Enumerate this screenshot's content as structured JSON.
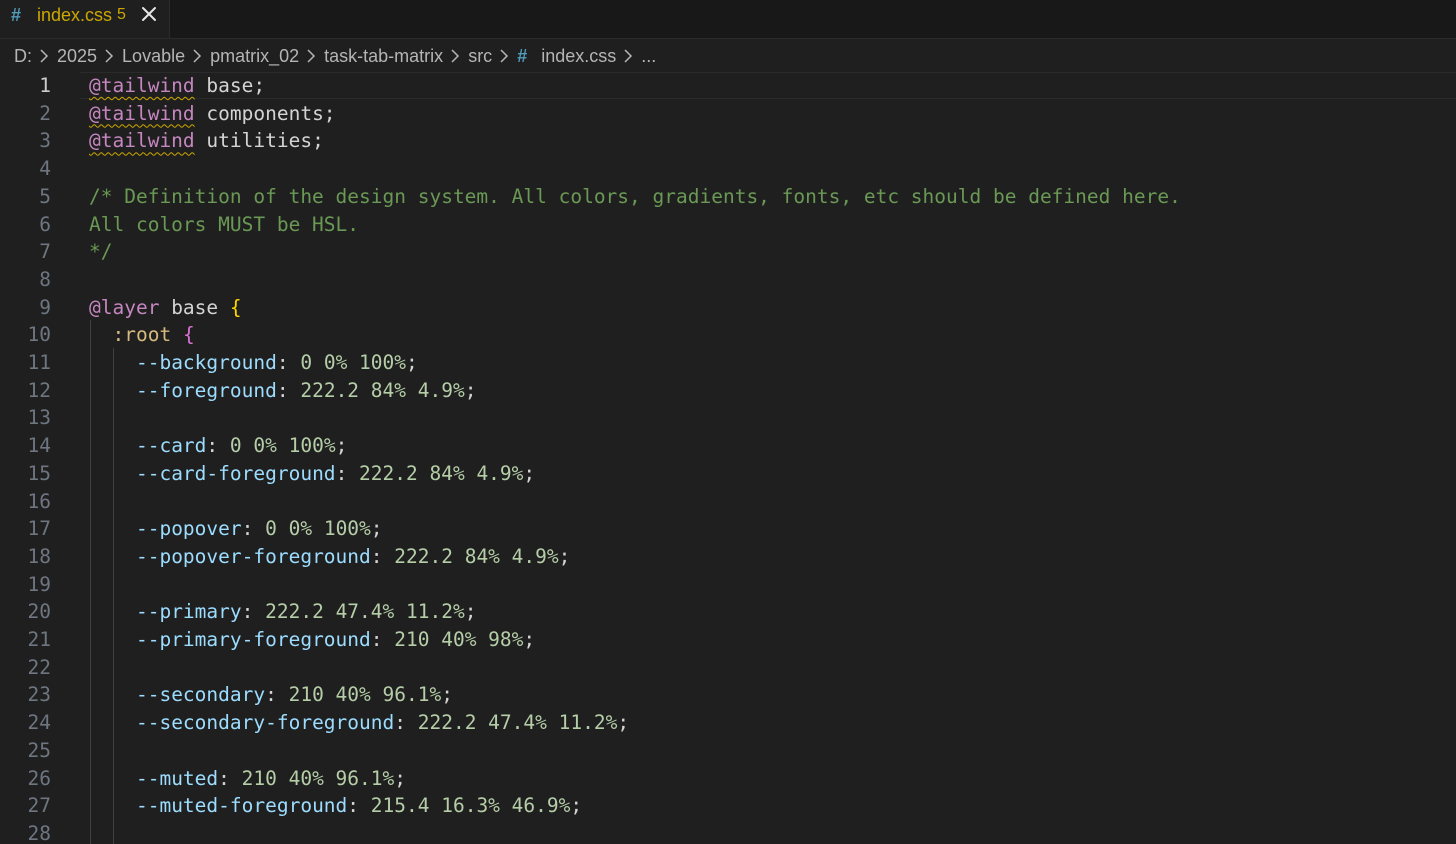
{
  "tab": {
    "icon": "css-hash-icon",
    "icon_glyph": "#",
    "filename": "index.css",
    "problem_count": "5",
    "close_icon": "close-icon"
  },
  "breadcrumb": {
    "segments": [
      "D:",
      "2025",
      "Lovable",
      "pmatrix_02",
      "task-tab-matrix",
      "src"
    ],
    "file_icon_glyph": "#",
    "file": "index.css",
    "more": "..."
  },
  "colors": {
    "background": "#1f1f1f",
    "at_rule": "#c586c0",
    "comment": "#6a9955",
    "property": "#9cdcfe",
    "value": "#b5cea8",
    "brace": "#ffd700",
    "warning": "#cca700"
  },
  "editor": {
    "active_line": 1,
    "lines": [
      {
        "n": "1",
        "tokens": [
          {
            "c": "atsq",
            "t": "@tailwind"
          },
          {
            "c": "plain",
            "t": " base;"
          }
        ]
      },
      {
        "n": "2",
        "tokens": [
          {
            "c": "atsq",
            "t": "@tailwind"
          },
          {
            "c": "plain",
            "t": " components;"
          }
        ]
      },
      {
        "n": "3",
        "tokens": [
          {
            "c": "atsq",
            "t": "@tailwind"
          },
          {
            "c": "plain",
            "t": " utilities;"
          }
        ]
      },
      {
        "n": "4",
        "tokens": []
      },
      {
        "n": "5",
        "tokens": [
          {
            "c": "comment",
            "t": "/* Definition of the design system. All colors, gradients, fonts, etc should be defined here."
          }
        ]
      },
      {
        "n": "6",
        "tokens": [
          {
            "c": "comment",
            "t": "All colors MUST be HSL."
          }
        ]
      },
      {
        "n": "7",
        "tokens": [
          {
            "c": "comment",
            "t": "*/"
          }
        ]
      },
      {
        "n": "8",
        "tokens": []
      },
      {
        "n": "9",
        "tokens": [
          {
            "c": "at",
            "t": "@layer"
          },
          {
            "c": "plain",
            "t": " base "
          },
          {
            "c": "brace-1",
            "t": "{"
          }
        ]
      },
      {
        "n": "10",
        "tokens": [
          {
            "c": "plain",
            "t": "  "
          },
          {
            "c": "selector",
            "t": ":root"
          },
          {
            "c": "plain",
            "t": " "
          },
          {
            "c": "brace-2",
            "t": "{"
          }
        ]
      },
      {
        "n": "11",
        "tokens": [
          {
            "c": "plain",
            "t": "    "
          },
          {
            "c": "prop",
            "t": "--background"
          },
          {
            "c": "plain",
            "t": ": "
          },
          {
            "c": "val",
            "t": "0 0% 100%"
          },
          {
            "c": "plain",
            "t": ";"
          }
        ]
      },
      {
        "n": "12",
        "tokens": [
          {
            "c": "plain",
            "t": "    "
          },
          {
            "c": "prop",
            "t": "--foreground"
          },
          {
            "c": "plain",
            "t": ": "
          },
          {
            "c": "val",
            "t": "222.2 84% 4.9%"
          },
          {
            "c": "plain",
            "t": ";"
          }
        ]
      },
      {
        "n": "13",
        "tokens": []
      },
      {
        "n": "14",
        "tokens": [
          {
            "c": "plain",
            "t": "    "
          },
          {
            "c": "prop",
            "t": "--card"
          },
          {
            "c": "plain",
            "t": ": "
          },
          {
            "c": "val",
            "t": "0 0% 100%"
          },
          {
            "c": "plain",
            "t": ";"
          }
        ]
      },
      {
        "n": "15",
        "tokens": [
          {
            "c": "plain",
            "t": "    "
          },
          {
            "c": "prop",
            "t": "--card-foreground"
          },
          {
            "c": "plain",
            "t": ": "
          },
          {
            "c": "val",
            "t": "222.2 84% 4.9%"
          },
          {
            "c": "plain",
            "t": ";"
          }
        ]
      },
      {
        "n": "16",
        "tokens": []
      },
      {
        "n": "17",
        "tokens": [
          {
            "c": "plain",
            "t": "    "
          },
          {
            "c": "prop",
            "t": "--popover"
          },
          {
            "c": "plain",
            "t": ": "
          },
          {
            "c": "val",
            "t": "0 0% 100%"
          },
          {
            "c": "plain",
            "t": ";"
          }
        ]
      },
      {
        "n": "18",
        "tokens": [
          {
            "c": "plain",
            "t": "    "
          },
          {
            "c": "prop",
            "t": "--popover-foreground"
          },
          {
            "c": "plain",
            "t": ": "
          },
          {
            "c": "val",
            "t": "222.2 84% 4.9%"
          },
          {
            "c": "plain",
            "t": ";"
          }
        ]
      },
      {
        "n": "19",
        "tokens": []
      },
      {
        "n": "20",
        "tokens": [
          {
            "c": "plain",
            "t": "    "
          },
          {
            "c": "prop",
            "t": "--primary"
          },
          {
            "c": "plain",
            "t": ": "
          },
          {
            "c": "val",
            "t": "222.2 47.4% 11.2%"
          },
          {
            "c": "plain",
            "t": ";"
          }
        ]
      },
      {
        "n": "21",
        "tokens": [
          {
            "c": "plain",
            "t": "    "
          },
          {
            "c": "prop",
            "t": "--primary-foreground"
          },
          {
            "c": "plain",
            "t": ": "
          },
          {
            "c": "val",
            "t": "210 40% 98%"
          },
          {
            "c": "plain",
            "t": ";"
          }
        ]
      },
      {
        "n": "22",
        "tokens": []
      },
      {
        "n": "23",
        "tokens": [
          {
            "c": "plain",
            "t": "    "
          },
          {
            "c": "prop",
            "t": "--secondary"
          },
          {
            "c": "plain",
            "t": ": "
          },
          {
            "c": "val",
            "t": "210 40% 96.1%"
          },
          {
            "c": "plain",
            "t": ";"
          }
        ]
      },
      {
        "n": "24",
        "tokens": [
          {
            "c": "plain",
            "t": "    "
          },
          {
            "c": "prop",
            "t": "--secondary-foreground"
          },
          {
            "c": "plain",
            "t": ": "
          },
          {
            "c": "val",
            "t": "222.2 47.4% 11.2%"
          },
          {
            "c": "plain",
            "t": ";"
          }
        ]
      },
      {
        "n": "25",
        "tokens": []
      },
      {
        "n": "26",
        "tokens": [
          {
            "c": "plain",
            "t": "    "
          },
          {
            "c": "prop",
            "t": "--muted"
          },
          {
            "c": "plain",
            "t": ": "
          },
          {
            "c": "val",
            "t": "210 40% 96.1%"
          },
          {
            "c": "plain",
            "t": ";"
          }
        ]
      },
      {
        "n": "27",
        "tokens": [
          {
            "c": "plain",
            "t": "    "
          },
          {
            "c": "prop",
            "t": "--muted-foreground"
          },
          {
            "c": "plain",
            "t": ": "
          },
          {
            "c": "val",
            "t": "215.4 16.3% 46.9%"
          },
          {
            "c": "plain",
            "t": ";"
          }
        ]
      },
      {
        "n": "28",
        "tokens": []
      }
    ]
  }
}
